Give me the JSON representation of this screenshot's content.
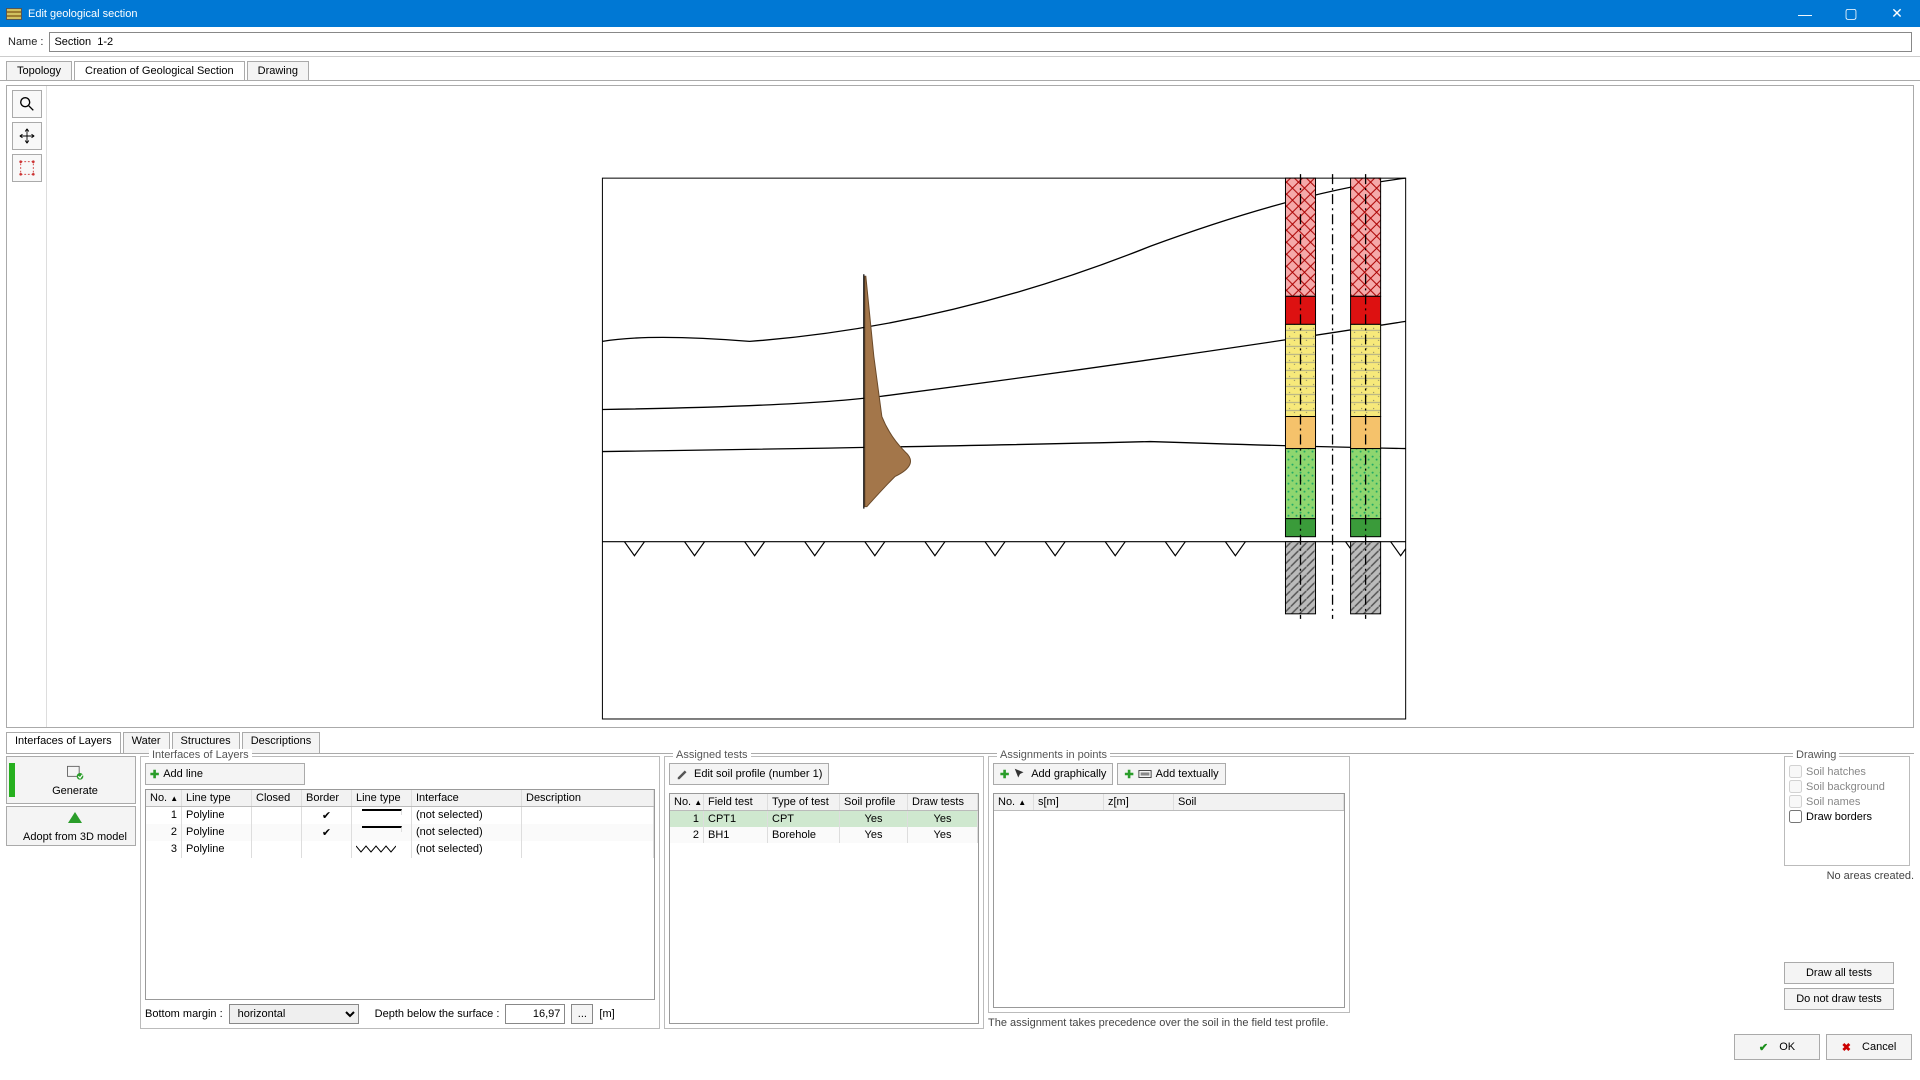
{
  "window": {
    "title": "Edit geological section"
  },
  "name": {
    "label": "Name :",
    "value": "Section  1-2"
  },
  "toptabs": {
    "topology": "Topology",
    "creation": "Creation of Geological Section",
    "drawing": "Drawing"
  },
  "subtabs": {
    "iol": "Interfaces of Layers",
    "water": "Water",
    "structures": "Structures",
    "descriptions": "Descriptions"
  },
  "leftbtns": {
    "generate": "Generate",
    "adopt": "Adopt from 3D model"
  },
  "iol": {
    "title": "Interfaces of Layers",
    "addline": "Add line",
    "headers": {
      "no": "No.",
      "ltype": "Line type",
      "closed": "Closed",
      "border": "Border",
      "ltype2": "Line type",
      "iface": "Interface",
      "desc": "Description"
    },
    "rows": [
      {
        "no": "1",
        "ltype": "Polyline",
        "closed": "",
        "border": "✔",
        "lvis": "solid",
        "iface": "(not selected)",
        "desc": ""
      },
      {
        "no": "2",
        "ltype": "Polyline",
        "closed": "",
        "border": "✔",
        "lvis": "solid",
        "iface": "(not selected)",
        "desc": ""
      },
      {
        "no": "3",
        "ltype": "Polyline",
        "closed": "",
        "border": "",
        "lvis": "rock",
        "iface": "(not selected)",
        "desc": ""
      }
    ],
    "bottom": {
      "bm_label": "Bottom margin :",
      "bm_value": "horizontal",
      "depth_label": "Depth below the surface :",
      "depth_value": "16,97",
      "unit": "[m]",
      "dots": "..."
    }
  },
  "assigned": {
    "title": "Assigned tests",
    "editbtn": "Edit soil profile (number 1)",
    "headers": {
      "no": "No.",
      "ft": "Field test",
      "tt": "Type of test",
      "sp": "Soil profile",
      "dt": "Draw tests"
    },
    "rows": [
      {
        "no": "1",
        "ft": "CPT1",
        "tt": "CPT",
        "sp": "Yes",
        "dt": "Yes",
        "sel": true
      },
      {
        "no": "2",
        "ft": "BH1",
        "tt": "Borehole",
        "sp": "Yes",
        "dt": "Yes"
      }
    ]
  },
  "points": {
    "title": "Assignments in points",
    "addg": "Add graphically",
    "addt": "Add textually",
    "headers": {
      "no": "No.",
      "s": "s[m]",
      "z": "z[m]",
      "soil": "Soil"
    },
    "note": "The assignment takes precedence over the soil in the field test profile."
  },
  "drawing": {
    "title": "Drawing",
    "soilh": "Soil hatches",
    "soilbg": "Soil background",
    "soiln": "Soil names",
    "drawb": "Draw borders",
    "noareas": "No areas created.",
    "drawall": "Draw all tests",
    "donot": "Do not draw tests"
  },
  "footer": {
    "ok": "OK",
    "cancel": "Cancel"
  }
}
